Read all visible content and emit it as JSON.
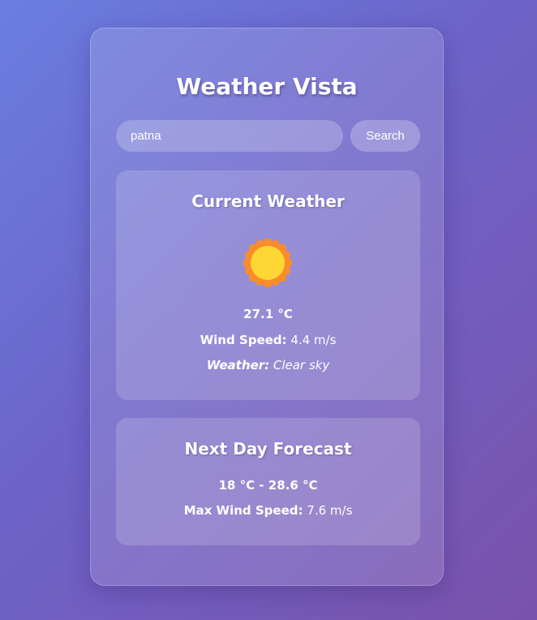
{
  "app": {
    "title": "Weather Vista"
  },
  "search": {
    "value": "patna",
    "button_label": "Search"
  },
  "current": {
    "heading": "Current Weather",
    "icon": "sun-icon",
    "temperature": "27.1 °C",
    "wind_label": "Wind Speed:",
    "wind_value": "4.4 m/s",
    "weather_label": "Weather:",
    "weather_value": "Clear sky"
  },
  "forecast": {
    "heading": "Next Day Forecast",
    "temp_range": "18 °C - 28.6 °C",
    "max_wind_label": "Max Wind Speed:",
    "max_wind_value": "7.6 m/s"
  },
  "colors": {
    "sun_core": "#fdd835",
    "sun_rays": "#fb8c2b"
  }
}
